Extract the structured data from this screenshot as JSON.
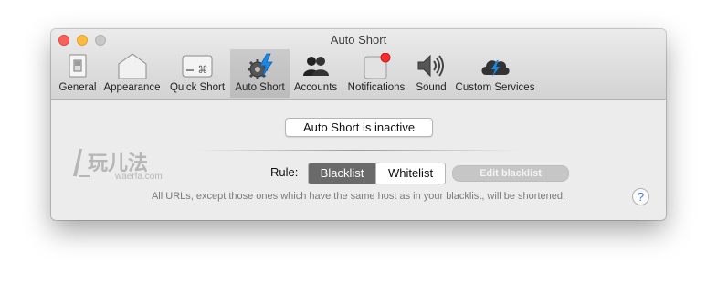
{
  "window": {
    "title": "Auto Short"
  },
  "toolbar": {
    "tabs": [
      {
        "label": "General",
        "icon": "general-switch-icon"
      },
      {
        "label": "Appearance",
        "icon": "appearance-icon"
      },
      {
        "label": "Quick Short",
        "icon": "keyboard-command-icon"
      },
      {
        "label": "Auto Short",
        "icon": "gear-bolt-icon",
        "selected": true
      },
      {
        "label": "Accounts",
        "icon": "accounts-icon"
      },
      {
        "label": "Notifications",
        "icon": "notification-badge-icon"
      },
      {
        "label": "Sound",
        "icon": "speaker-icon"
      },
      {
        "label": "Custom Services",
        "icon": "cloud-bolt-icon"
      }
    ]
  },
  "content": {
    "status_button": "Auto Short is inactive",
    "rule_label": "Rule:",
    "segment": {
      "blacklist": "Blacklist",
      "whitelist": "Whitelist",
      "selected": "Blacklist"
    },
    "edit_button": "Edit blacklist",
    "description": "All URLs, except those ones which have the same host as in your blacklist, will be shortened.",
    "help": "?"
  },
  "watermark": {
    "main": "玩儿法",
    "sub": "waerfa.com"
  },
  "colors": {
    "accent_blue": "#1e88e5",
    "badge_red": "#ff2a2a",
    "selected_segment": "#6a6a6a"
  }
}
